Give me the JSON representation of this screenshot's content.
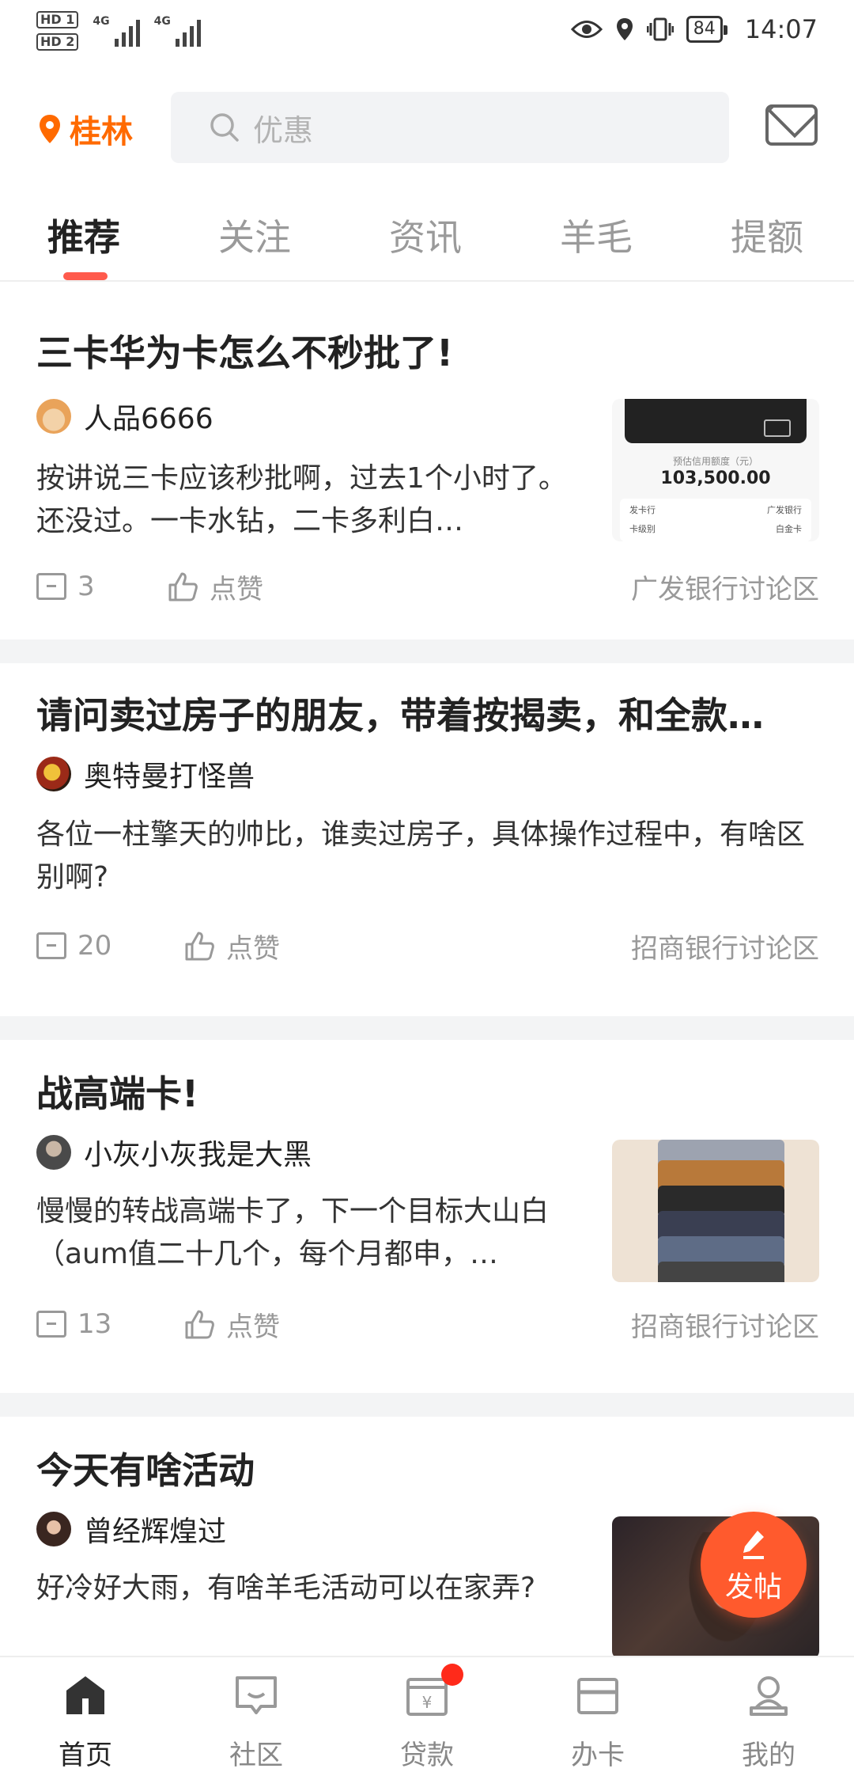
{
  "status_bar": {
    "sim1": "HD 1",
    "sim2": "HD 2",
    "net1": "4G",
    "net2": "4G",
    "battery": "84",
    "time": "14:07"
  },
  "header": {
    "city": "桂林",
    "search_placeholder": "优惠"
  },
  "tabs": [
    "推荐",
    "关注",
    "资讯",
    "羊毛",
    "提额"
  ],
  "active_tab": "推荐",
  "posts": [
    {
      "title": "三卡华为卡怎么不秒批了!",
      "author": "人品6666",
      "excerpt": "按讲说三卡应该秒批啊，过去1个小时了。还没过。一卡水钻，二卡多利白…",
      "comments": "3",
      "like_label": "点赞",
      "forum": "广发银行讨论区",
      "thumb": {
        "caption": "预估信用额度（元）",
        "amount": "103,500.00",
        "row1_left": "发卡行",
        "row1_right": "广发银行",
        "row2_left": "卡级别",
        "row2_right": "白金卡"
      }
    },
    {
      "title": "请问卖过房子的朋友，带着按揭卖，和全款…",
      "author": "奥特曼打怪兽",
      "excerpt": "各位一柱擎天的帅比，谁卖过房子，具体操作过程中，有啥区别啊?",
      "comments": "20",
      "like_label": "点赞",
      "forum": "招商银行讨论区"
    },
    {
      "title": "战高端卡!",
      "author": "小灰小灰我是大黑",
      "excerpt": "慢慢的转战高端卡了，下一个目标大山白（aum值二十几个，每个月都申，…",
      "comments": "13",
      "like_label": "点赞",
      "forum": "招商银行讨论区"
    },
    {
      "title": "今天有啥活动",
      "author": "曾经辉煌过",
      "excerpt": "好冷好大雨，有啥羊毛活动可以在家弄?"
    }
  ],
  "fab_label": "发帖",
  "bottom_nav": [
    "首页",
    "社区",
    "贷款",
    "办卡",
    "我的"
  ],
  "colors": {
    "accent": "#ff6a00",
    "tab_indicator": "#ff5a4c",
    "fab": "#ff5a2d",
    "badge": "#ff2a1a"
  }
}
